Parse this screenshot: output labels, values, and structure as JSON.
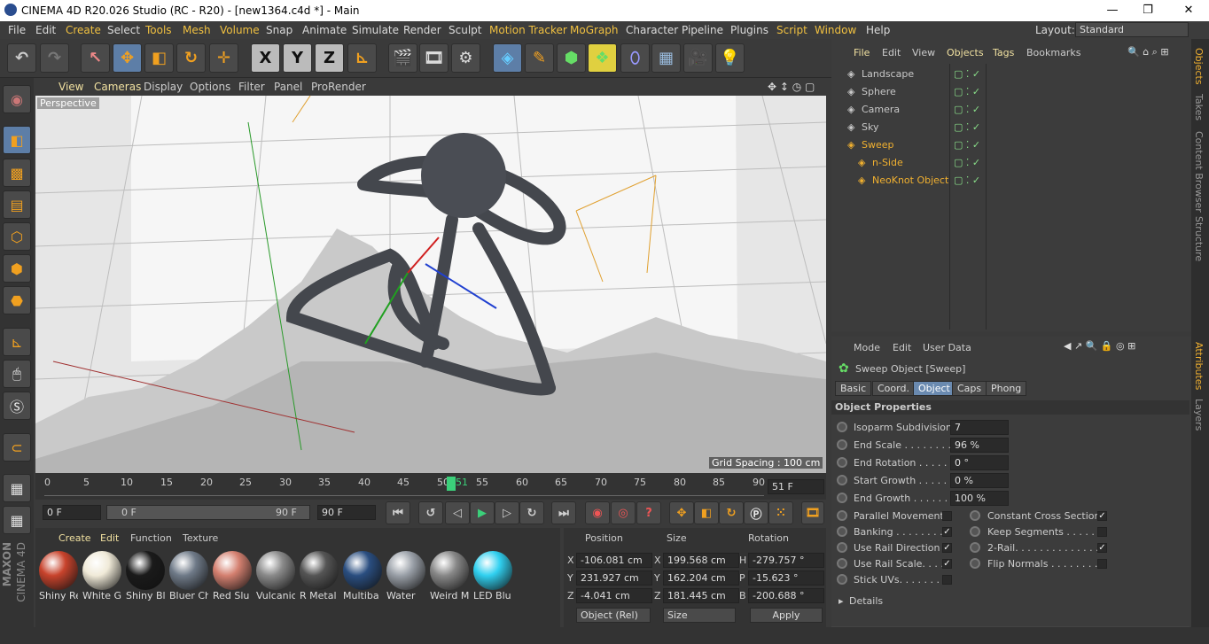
{
  "window": {
    "title": "CINEMA 4D R20.026 Studio (RC - R20) - [new1364.c4d *] - Main",
    "minimize": "—",
    "maximize": "❐",
    "close": "✕"
  },
  "menubar": {
    "items": [
      "File",
      "Edit",
      "Create",
      "Select",
      "Tools",
      "Mesh",
      "Volume",
      "Snap",
      "Animate",
      "Simulate",
      "Render",
      "Sculpt",
      "Motion Tracker",
      "MoGraph",
      "Character",
      "Pipeline",
      "Plugins",
      "Script",
      "Window",
      "Help"
    ],
    "highlighted": [
      "Create",
      "Tools",
      "Mesh",
      "Volume",
      "Motion Tracker",
      "MoGraph",
      "Script",
      "Window"
    ],
    "layout_label": "Layout:",
    "layout_value": "Standard"
  },
  "toolbar": {
    "icons": [
      "undo-icon",
      "redo-icon",
      "live-selection-icon",
      "move-icon",
      "scale-icon",
      "rotate-icon",
      "recent-tool-icon",
      "x-axis-icon",
      "y-axis-icon",
      "z-axis-icon",
      "coordinate-system-icon",
      "render-view-icon",
      "render-picture-viewer-icon",
      "edit-render-settings-icon",
      "cube-icon",
      "pen-icon",
      "subdivision-icon",
      "array-icon",
      "deformer-icon",
      "floor-icon",
      "camera-icon",
      "light-icon"
    ],
    "axis_labels": [
      "X",
      "Y",
      "Z"
    ]
  },
  "viewport": {
    "menu": [
      "View",
      "Cameras",
      "Display",
      "Options",
      "Filter",
      "Panel",
      "ProRender"
    ],
    "label": "Perspective",
    "grid_spacing": "Grid Spacing : 100 cm"
  },
  "timeline": {
    "ticks": [
      "0",
      "5",
      "10",
      "15",
      "20",
      "25",
      "30",
      "35",
      "40",
      "45",
      "50",
      "55",
      "60",
      "65",
      "70",
      "75",
      "80",
      "85",
      "90"
    ],
    "current_frame": "51",
    "frame_field": "51 F"
  },
  "playbar": {
    "start": "0 F",
    "range_start": "0 F",
    "range_end": "90 F",
    "end": "90 F"
  },
  "materials": {
    "menu": [
      "Create",
      "Edit",
      "Function",
      "Texture"
    ],
    "items": [
      {
        "name": "Shiny Re",
        "color": "#c8432c"
      },
      {
        "name": "White G",
        "color": "#f0ead8"
      },
      {
        "name": "Shiny Bl",
        "color": "#1a1a1a"
      },
      {
        "name": "Bluer Ch",
        "color": "#6f7a88"
      },
      {
        "name": "Red Slu",
        "color": "#d48070"
      },
      {
        "name": "Vulcanic",
        "color": "#8a8a8a"
      },
      {
        "name": "R Metal",
        "color": "#555"
      },
      {
        "name": "Multiba",
        "color": "#2a4e80"
      },
      {
        "name": "Water",
        "color": "#9aa0a8"
      },
      {
        "name": "Weird M",
        "color": "#888"
      },
      {
        "name": "LED Blu",
        "color": "#30d0f0"
      }
    ]
  },
  "coordinates": {
    "headers": [
      "Position",
      "Size",
      "Rotation"
    ],
    "rows": [
      {
        "axis": "X",
        "pos": "-106.081 cm",
        "saxis": "X",
        "size": "199.568 cm",
        "raxis": "H",
        "rot": "-279.757 °"
      },
      {
        "axis": "Y",
        "pos": "231.927 cm",
        "saxis": "Y",
        "size": "162.204 cm",
        "raxis": "P",
        "rot": "-15.623 °"
      },
      {
        "axis": "Z",
        "pos": "-4.041 cm",
        "saxis": "Z",
        "size": "181.445 cm",
        "raxis": "B",
        "rot": "-200.688 °"
      }
    ],
    "mode": "Object (Rel)",
    "size_mode": "Size",
    "apply": "Apply"
  },
  "objects": {
    "menu": [
      "File",
      "Edit",
      "View",
      "Objects",
      "Tags",
      "Bookmarks"
    ],
    "highlighted": [
      "File",
      "Objects",
      "Tags"
    ],
    "items": [
      {
        "name": "Landscape",
        "color": "#c8c8c8",
        "indent": 0
      },
      {
        "name": "Sphere",
        "color": "#c8c8c8",
        "indent": 0
      },
      {
        "name": "Camera",
        "color": "#c8c8c8",
        "indent": 0
      },
      {
        "name": "Sky",
        "color": "#c8c8c8",
        "indent": 0
      },
      {
        "name": "Sweep",
        "color": "#f0b030",
        "indent": 0
      },
      {
        "name": "n-Side",
        "color": "#f0b030",
        "indent": 1
      },
      {
        "name": "NeoKnot Object",
        "color": "#f0b030",
        "indent": 1
      }
    ]
  },
  "attributes": {
    "menu": [
      "Mode",
      "Edit",
      "User Data"
    ],
    "object_title": "Sweep Object [Sweep]",
    "tabs": [
      "Basic",
      "Coord.",
      "Object",
      "Caps",
      "Phong"
    ],
    "active_tab": "Object",
    "section": "Object Properties",
    "fields": [
      {
        "label": "Isoparm Subdivision",
        "value": "7"
      },
      {
        "label": "End Scale . . . . . . . . .",
        "value": "96 %"
      },
      {
        "label": "End Rotation . . . . . .",
        "value": "0 °"
      },
      {
        "label": "Start Growth . . . . . .",
        "value": "0 %"
      },
      {
        "label": "End Growth . . . . . . .",
        "value": "100 %"
      }
    ],
    "checks_left": [
      {
        "label": "Parallel Movement",
        "checked": ""
      },
      {
        "label": "Banking . . . . . . . .",
        "checked": "✓"
      },
      {
        "label": "Use Rail Direction",
        "checked": "✓"
      },
      {
        "label": "Use Rail Scale. . . .",
        "checked": "✓"
      },
      {
        "label": "Stick UVs. . . . . . .",
        "checked": ""
      }
    ],
    "checks_right": [
      {
        "label": "Constant Cross Section",
        "checked": "✓"
      },
      {
        "label": "Keep Segments . . . . . .",
        "checked": ""
      },
      {
        "label": "2-Rail. . . . . . . . . . . . . .",
        "checked": "✓"
      },
      {
        "label": "Flip Normals . . . . . . . . .",
        "checked": ""
      }
    ],
    "details": "Details"
  },
  "sidetabs": {
    "top": [
      "Objects",
      "Takes",
      "Content Browser",
      "Structure"
    ],
    "bottom": [
      "Attributes",
      "Layers"
    ]
  },
  "brand": {
    "maxon": "MAXON",
    "product": "CINEMA 4D"
  }
}
